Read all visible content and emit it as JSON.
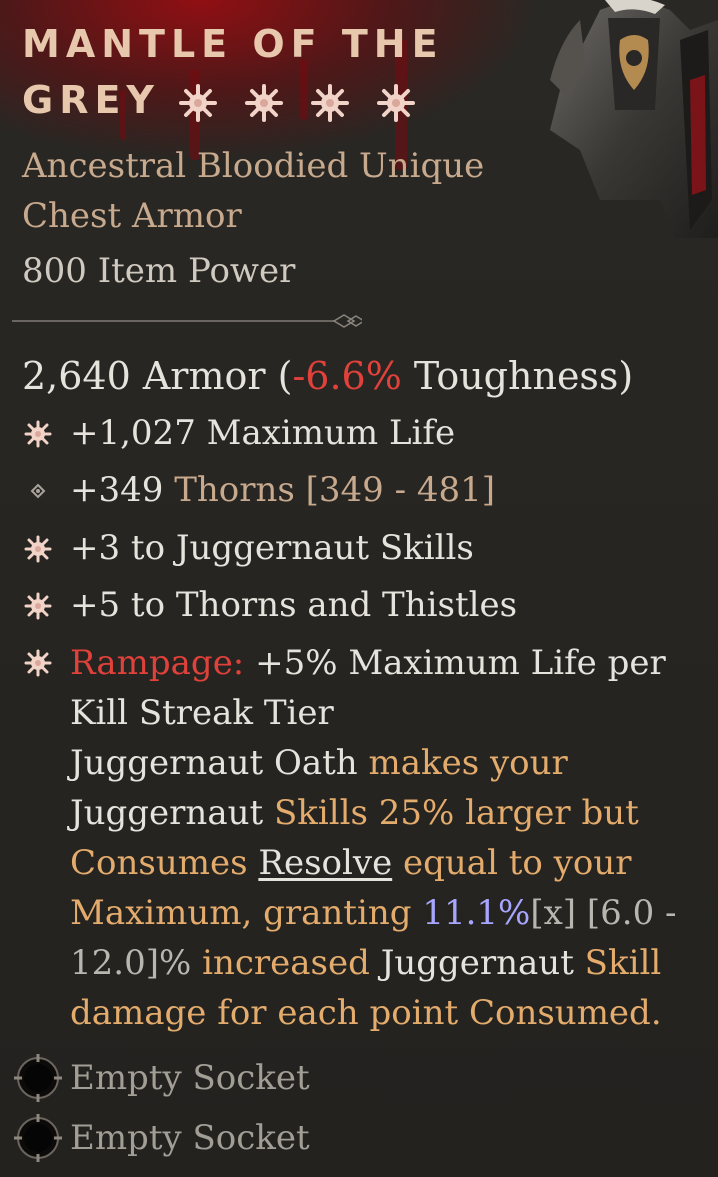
{
  "item": {
    "title": "Mantle of the Grey",
    "rank_stars": 4,
    "rarity_line": "Ancestral Bloodied Unique",
    "type_line": "Chest Armor",
    "item_power": "800 Item Power"
  },
  "armor": {
    "value": "2,640 Armor (",
    "toughness_change": "-6.6%",
    "toughness_label": " Toughness)"
  },
  "affixes": [
    {
      "text": "+1,027 Maximum Life",
      "icon": "greater-affix-star-icon"
    },
    {
      "value": "+349",
      "name": " Thorns",
      "range": " [349 - 481]",
      "icon": "diamond-bullet-icon"
    },
    {
      "text": "+3 to Juggernaut Skills",
      "icon": "greater-affix-star-icon"
    },
    {
      "text": "+5 to Thorns and Thistles",
      "icon": "greater-affix-star-icon"
    }
  ],
  "rampage": {
    "name": "Rampage:",
    "text_a": " +5% Maximum Life per",
    "text_b": "Kill Streak Tier",
    "icon": "greater-affix-star-icon"
  },
  "unique_power": {
    "p1": "Juggernaut Oath",
    "p2": " makes your",
    "p3": "Juggernaut",
    "p4": " Skills 25% larger but",
    "p5": "Consumes ",
    "p6": "Resolve",
    "p7": " equal to your",
    "p8": "Maximum, granting ",
    "p9": "11.1%",
    "p10": "[x]",
    "p11": " [6.0 -",
    "p12": "12.0]%",
    "p13": " increased ",
    "p14": "Juggernaut",
    "p15": " Skill",
    "p16": "damage for each point Consumed."
  },
  "sockets": [
    {
      "label": "Empty Socket",
      "icon": "empty-socket-icon"
    },
    {
      "label": "Empty Socket",
      "icon": "empty-socket-icon"
    }
  ],
  "colors": {
    "title": "#e7c8ad",
    "negative": "#e0413a",
    "highlight": "#e3ab6c",
    "value_blue": "#a7a6ff",
    "body_text": "#e6e2dc"
  }
}
